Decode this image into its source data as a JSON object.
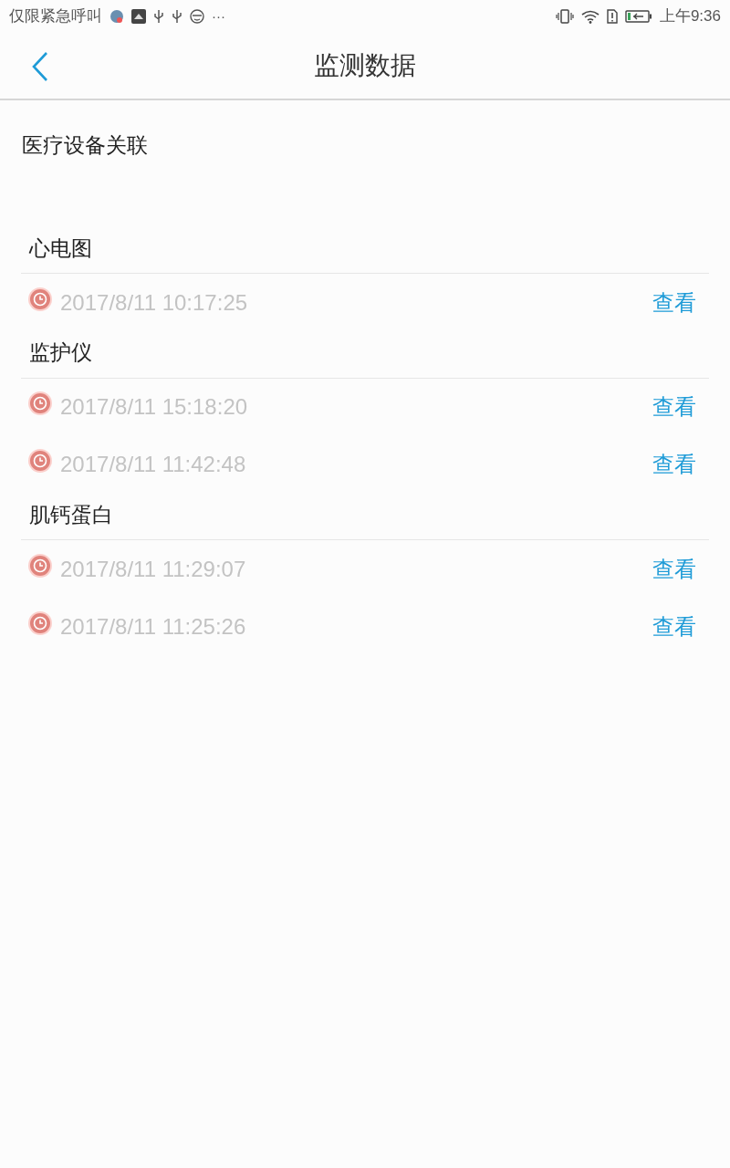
{
  "status_bar": {
    "carrier": "仅限紧急呼叫",
    "more": "···",
    "time": "上午9:36"
  },
  "header": {
    "title": "监测数据"
  },
  "subtitle": "医疗设备关联",
  "sections": [
    {
      "title": "心电图",
      "records": [
        {
          "time": "2017/8/11 10:17:25",
          "action": "查看"
        }
      ]
    },
    {
      "title": "监护仪",
      "records": [
        {
          "time": "2017/8/11 15:18:20",
          "action": "查看"
        },
        {
          "time": "2017/8/11 11:42:48",
          "action": "查看"
        }
      ]
    },
    {
      "title": "肌钙蛋白",
      "records": [
        {
          "time": "2017/8/11 11:29:07",
          "action": "查看"
        },
        {
          "time": "2017/8/11 11:25:26",
          "action": "查看"
        }
      ]
    }
  ]
}
